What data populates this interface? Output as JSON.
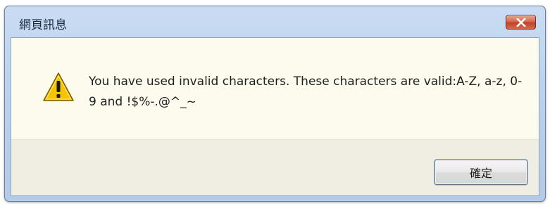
{
  "window": {
    "title": "網頁訊息"
  },
  "titlebar": {
    "close_icon": "close-icon"
  },
  "dialog": {
    "icon": "warning-icon",
    "message": "You have used invalid characters. These characters are valid:A-Z, a-z, 0-9 and !$%-.@^_~",
    "ok_label": "確定"
  },
  "colors": {
    "content_background": "#fdfbed",
    "button_area_background": "#f0eee2",
    "close_button": "#c0422b",
    "warning_fill": "#f5c400"
  }
}
